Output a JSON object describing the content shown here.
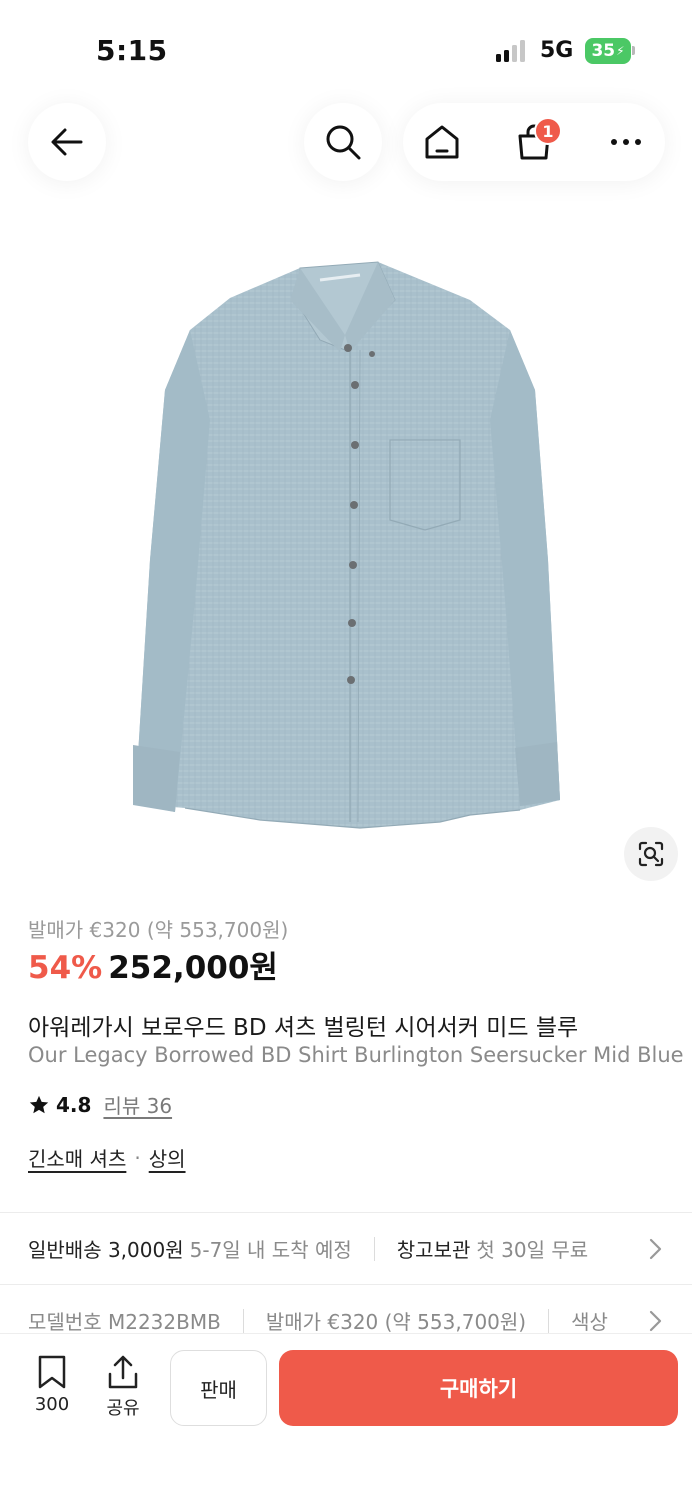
{
  "status_bar": {
    "time": "5:15",
    "network": "5G",
    "battery": "35"
  },
  "nav": {
    "cart_count": "1"
  },
  "product": {
    "original_price": "발매가 €320 (약 553,700원)",
    "discount": "54%",
    "price": "252,000원",
    "title_ko": "아워레가시 보로우드 BD 셔츠 벌링턴 시어서커 미드 블루",
    "title_en": "Our Legacy Borrowed BD Shirt Burlington Seersucker Mid Blue",
    "rating": "4.8",
    "review_label": "리뷰 36",
    "categories": [
      "긴소매 셔츠",
      "상의"
    ],
    "category_separator": "·"
  },
  "shipping": {
    "standard_label": "일반배송 3,000원",
    "standard_eta": "5-7일 내 도착 예정",
    "storage_label": "창고보관",
    "storage_note": "첫 30일 무료"
  },
  "specs": {
    "model_label": "모델번호 M2232BMB",
    "release_label": "발매가 €320 (약 553,700원)",
    "color_label": "색상"
  },
  "bottom_bar": {
    "wish_count": "300",
    "share_label": "공유",
    "sell_label": "판매",
    "buy_label": "구매하기"
  },
  "colors": {
    "accent": "#ef5a4a",
    "shirt": "#a9c0cc"
  },
  "icons": [
    "back-arrow-icon",
    "search-icon",
    "home-icon",
    "cart-icon",
    "more-icon",
    "lens-icon",
    "star-icon",
    "chevron-right-icon",
    "bookmark-icon",
    "share-icon"
  ]
}
